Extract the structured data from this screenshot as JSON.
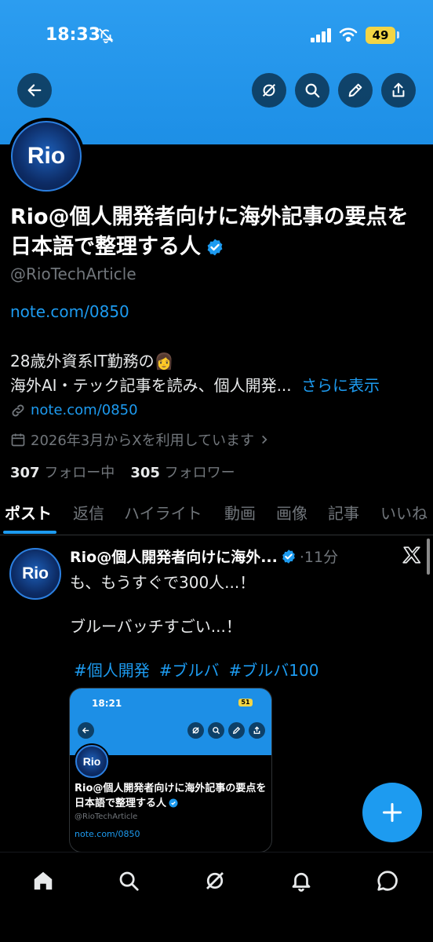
{
  "status_bar": {
    "time": "18:33",
    "battery": "49"
  },
  "profile": {
    "avatar_text": "Rio",
    "name": "Rio@個人開発者向けに海外記事の要点を日本語で整理する人",
    "handle": "@RioTechArticle",
    "website": "note.com/0850",
    "bio_line1": "28歳外資系IT勤務の👩",
    "bio_line2": "海外AI・テック記事を読み、個人開発...",
    "show_more": "さらに表示",
    "link": "note.com/0850",
    "joined": "2026年3月からXを利用しています",
    "following_count": "307",
    "following_label": "フォロー中",
    "followers_count": "305",
    "followers_label": "フォロワー"
  },
  "tabs": [
    "ポスト",
    "返信",
    "ハイライト",
    "動画",
    "画像",
    "記事",
    "いいね"
  ],
  "post": {
    "avatar_text": "Rio",
    "author": "Rio@個人開発者向けに海外...",
    "time": "·11分",
    "line1": "も、もうすぐで300人...！",
    "line2": "ブルーバッチすごい...！",
    "hashtags": [
      "#個人開発",
      "#ブルバ",
      "#ブルバ100"
    ]
  },
  "embed": {
    "time": "18:21",
    "battery": "51",
    "avatar_text": "Rio",
    "name": "Rio@個人開発者向けに海外記事の要点を日本語で整理する人",
    "handle": "@RioTechArticle",
    "link": "note.com/0850"
  },
  "colors": {
    "accent": "#1d9bf0",
    "banner": "#1d8fe6",
    "battery": "#f3d545"
  }
}
